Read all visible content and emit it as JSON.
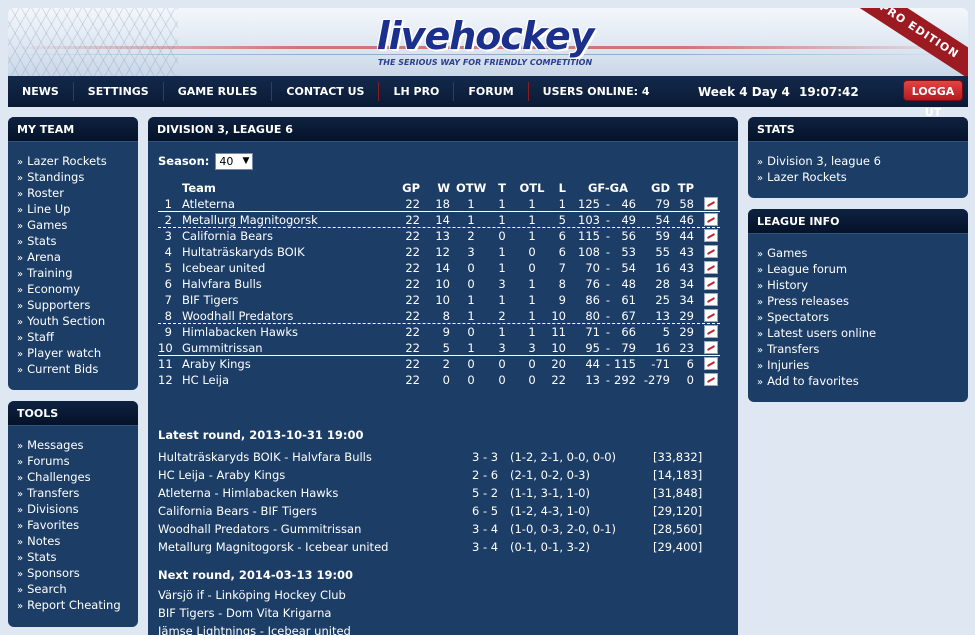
{
  "header": {
    "logo": "livehockey",
    "tagline": "THE SERIOUS WAY FOR FRIENDLY COMPETITION",
    "pro_badge": "PRO EDITION"
  },
  "nav": {
    "items": [
      "NEWS",
      "SETTINGS",
      "GAME RULES",
      "CONTACT US",
      "LH PRO",
      "FORUM",
      "USERS ONLINE: 4"
    ],
    "week": "Week 4 Day 4",
    "clock": "19:07:42",
    "logout": "LOGGA UT"
  },
  "my_team": {
    "title": "MY TEAM",
    "items": [
      "Lazer Rockets",
      "Standings",
      "Roster",
      "Line Up",
      "Games",
      "Stats",
      "Arena",
      "Training",
      "Economy",
      "Supporters",
      "Youth Section",
      "Staff",
      "Player watch",
      "Current Bids"
    ]
  },
  "tools": {
    "title": "TOOLS",
    "items": [
      "Messages",
      "Forums",
      "Challenges",
      "Transfers",
      "Divisions",
      "Favorites",
      "Notes",
      "Stats",
      "Sponsors",
      "Search",
      "Report Cheating"
    ]
  },
  "stats": {
    "title": "STATS",
    "items": [
      "Division 3, league 6",
      "Lazer Rockets"
    ]
  },
  "league_info": {
    "title": "LEAGUE INFO",
    "items": [
      "Games",
      "League forum",
      "History",
      "Press releases",
      "Spectators",
      "Latest users online",
      "Transfers",
      "Injuries",
      "Add to favorites"
    ]
  },
  "main": {
    "title": "DIVISION 3, LEAGUE 6",
    "season_label": "Season:",
    "season_value": "40",
    "columns": {
      "team": "Team",
      "gp": "GP",
      "w": "W",
      "otw": "OTW",
      "t": "T",
      "otl": "OTL",
      "l": "L",
      "gfga": "GF-GA",
      "gd": "GD",
      "tp": "TP"
    },
    "standings": [
      {
        "pos": "1",
        "team": "Atleterna",
        "gp": "22",
        "w": "18",
        "otw": "1",
        "t": "1",
        "otl": "1",
        "l": "1",
        "gf": "125",
        "ga": "46",
        "gd": "79",
        "tp": "58"
      },
      {
        "pos": "2",
        "team": "Metallurg Magnitogorsk",
        "gp": "22",
        "w": "14",
        "otw": "1",
        "t": "1",
        "otl": "1",
        "l": "5",
        "gf": "103",
        "ga": "49",
        "gd": "54",
        "tp": "46"
      },
      {
        "pos": "3",
        "team": "California Bears",
        "gp": "22",
        "w": "13",
        "otw": "2",
        "t": "0",
        "otl": "1",
        "l": "6",
        "gf": "115",
        "ga": "56",
        "gd": "59",
        "tp": "44"
      },
      {
        "pos": "4",
        "team": "Hultaträskaryds BOIK",
        "gp": "22",
        "w": "12",
        "otw": "3",
        "t": "1",
        "otl": "0",
        "l": "6",
        "gf": "108",
        "ga": "53",
        "gd": "55",
        "tp": "43"
      },
      {
        "pos": "5",
        "team": "Icebear united",
        "gp": "22",
        "w": "14",
        "otw": "0",
        "t": "1",
        "otl": "0",
        "l": "7",
        "gf": "70",
        "ga": "54",
        "gd": "16",
        "tp": "43"
      },
      {
        "pos": "6",
        "team": "Halvfara Bulls",
        "gp": "22",
        "w": "10",
        "otw": "0",
        "t": "3",
        "otl": "1",
        "l": "8",
        "gf": "76",
        "ga": "48",
        "gd": "28",
        "tp": "34"
      },
      {
        "pos": "7",
        "team": "BIF Tigers",
        "gp": "22",
        "w": "10",
        "otw": "1",
        "t": "1",
        "otl": "1",
        "l": "9",
        "gf": "86",
        "ga": "61",
        "gd": "25",
        "tp": "34"
      },
      {
        "pos": "8",
        "team": "Woodhall Predators",
        "gp": "22",
        "w": "8",
        "otw": "1",
        "t": "2",
        "otl": "1",
        "l": "10",
        "gf": "80",
        "ga": "67",
        "gd": "13",
        "tp": "29"
      },
      {
        "pos": "9",
        "team": "Himlabacken Hawks",
        "gp": "22",
        "w": "9",
        "otw": "0",
        "t": "1",
        "otl": "1",
        "l": "11",
        "gf": "71",
        "ga": "66",
        "gd": "5",
        "tp": "29"
      },
      {
        "pos": "10",
        "team": "Gummitrissan",
        "gp": "22",
        "w": "5",
        "otw": "1",
        "t": "3",
        "otl": "3",
        "l": "10",
        "gf": "95",
        "ga": "79",
        "gd": "16",
        "tp": "23"
      },
      {
        "pos": "11",
        "team": "Araby Kings",
        "gp": "22",
        "w": "2",
        "otw": "0",
        "t": "0",
        "otl": "0",
        "l": "20",
        "gf": "44",
        "ga": "115",
        "gd": "-71",
        "tp": "6"
      },
      {
        "pos": "12",
        "team": "HC Leija",
        "gp": "22",
        "w": "0",
        "otw": "0",
        "t": "0",
        "otl": "0",
        "l": "22",
        "gf": "13",
        "ga": "292",
        "gd": "-279",
        "tp": "0"
      }
    ],
    "latest_round_title": "Latest round, 2013-10-31 19:00",
    "latest_round": [
      {
        "match": "Hultaträskaryds BOIK - Halvfara Bulls",
        "score": "3 - 3",
        "periods": "(1-2, 2-1, 0-0, 0-0)",
        "spectators": "[33,832]"
      },
      {
        "match": "HC Leija - Araby Kings",
        "score": "2 - 6",
        "periods": "(2-1, 0-2, 0-3)",
        "spectators": "[14,183]"
      },
      {
        "match": "Atleterna - Himlabacken Hawks",
        "score": "5 - 2",
        "periods": "(1-1, 3-1, 1-0)",
        "spectators": "[31,848]"
      },
      {
        "match": "California Bears - BIF Tigers",
        "score": "6 - 5",
        "periods": "(1-2, 4-3, 1-0)",
        "spectators": "[29,120]"
      },
      {
        "match": "Woodhall Predators - Gummitrissan",
        "score": "3 - 4",
        "periods": "(1-0, 0-3, 2-0, 0-1)",
        "spectators": "[28,560]"
      },
      {
        "match": "Metallurg Magnitogorsk - Icebear united",
        "score": "3 - 4",
        "periods": "(0-1, 0-1, 3-2)",
        "spectators": "[29,400]"
      }
    ],
    "next_round_title": "Next round, 2014-03-13 19:00",
    "next_round": [
      "Värsjö if  - Linköping Hockey Club",
      "BIF Tigers  - Dom Vita Krigarna",
      "Jämse Lightnings  - Icebear united"
    ]
  }
}
